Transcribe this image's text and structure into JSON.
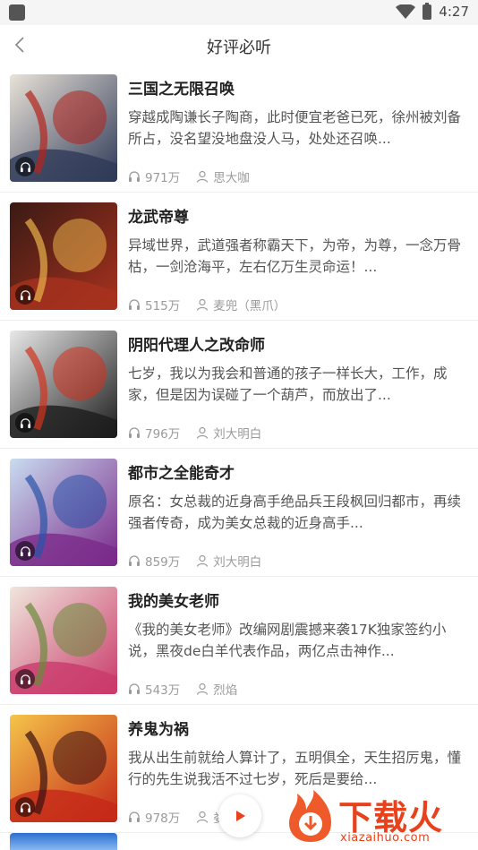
{
  "status_bar": {
    "time": "4:27"
  },
  "nav": {
    "title": "好评必听"
  },
  "books": [
    {
      "title": "三国之无限召唤",
      "desc": "穿越成陶谦长子陶商，此时便宜老爸已死，徐州被刘备所占，没名望没地盘没人马，处处还召唤...",
      "plays": "971万",
      "author": "思大咖",
      "cover_colors": [
        "#e9e2d8",
        "#2e3a57",
        "#b3231c"
      ]
    },
    {
      "title": "龙武帝尊",
      "desc": "异域世界，武道强者称霸天下，为帝，为尊，一念万骨枯，一剑沧海平，左右亿万生灵命运！...",
      "plays": "515万",
      "author": "麦兜（黑爪）",
      "cover_colors": [
        "#3a1a14",
        "#a8321e",
        "#e8b24a"
      ]
    },
    {
      "title": "阴阳代理人之改命师",
      "desc": "七岁，我以为我会和普通的孩子一样长大，工作，成家，但是因为误碰了一个葫芦，而放出了...",
      "plays": "796万",
      "author": "刘大明白",
      "cover_colors": [
        "#e8e8e8",
        "#1c1c1c",
        "#d2321d"
      ]
    },
    {
      "title": "都市之全能奇才",
      "desc": "原名：女总裁的近身高手绝品兵王段枫回归都市，再续强者传奇，成为美女总裁的近身高手...",
      "plays": "859万",
      "author": "刘大明白",
      "cover_colors": [
        "#c9dcf0",
        "#7a2a8a",
        "#2a52a8"
      ]
    },
    {
      "title": "我的美女老师",
      "desc": "《我的美女老师》改编网剧震撼来袭17K独家签约小说，黑夜de白羊代表作品，两亿点击神作...",
      "plays": "543万",
      "author": "烈焰",
      "cover_colors": [
        "#f0e6dc",
        "#c93a6a",
        "#6a8a3a"
      ]
    },
    {
      "title": "养鬼为祸",
      "desc": "我从出生前就给人算计了，五明俱全，天生招厉鬼，懂行的先生说我活不过七岁，死后是要给...",
      "plays": "978万",
      "author": "娄",
      "cover_colors": [
        "#f5c44a",
        "#c42818",
        "#3a1010"
      ]
    }
  ],
  "icons": {
    "back": "chevron-left-icon",
    "plays": "headphones-icon",
    "author": "person-icon",
    "cover_badge": "headphones-icon",
    "float": "play-icon"
  },
  "watermark": {
    "text": "下载火",
    "url": "xiazaihuo.com"
  },
  "colors": {
    "accent": "#e8421c",
    "muted": "#9a9a9a"
  }
}
